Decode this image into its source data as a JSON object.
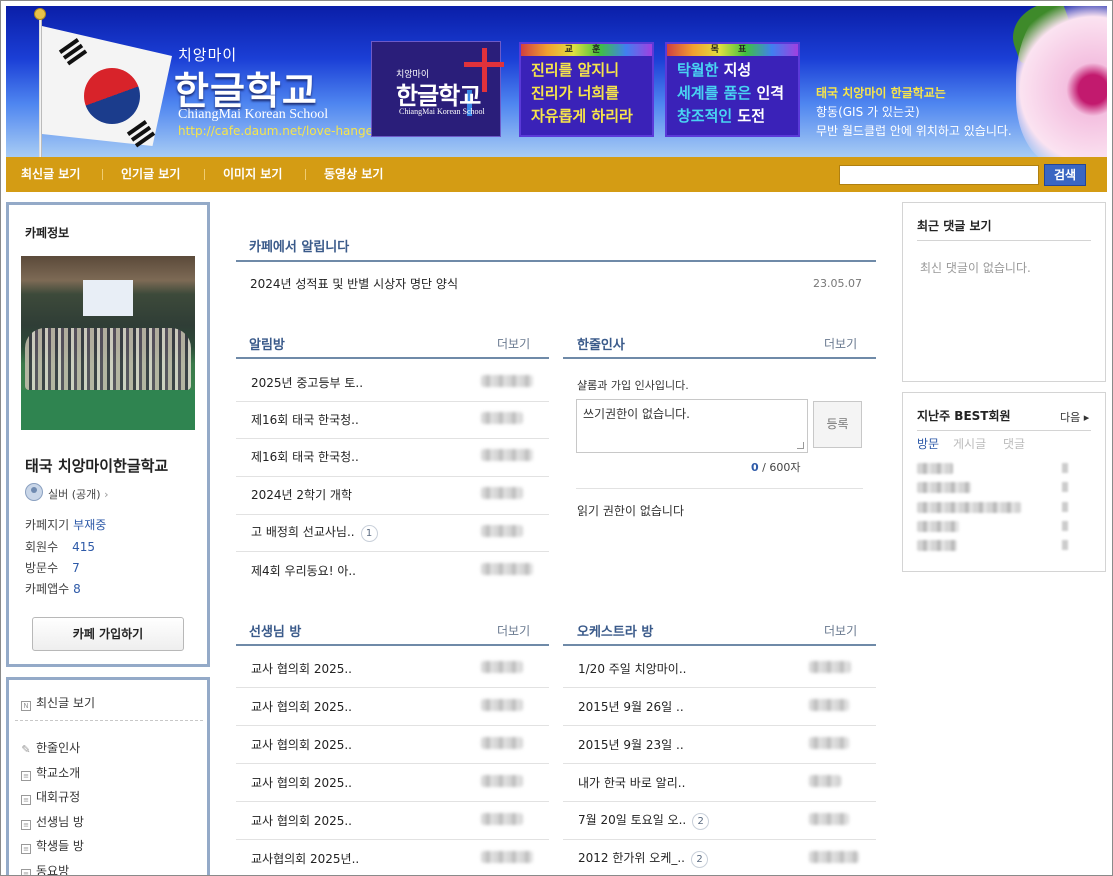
{
  "banner": {
    "small_title": "치앙마이",
    "title": "한글학교",
    "english": "ChiangMai Korean School",
    "url": "http://cafe.daum.net/love-hangeul",
    "logo_box": {
      "small": "치앙마이",
      "title": "한글학교",
      "english": "ChiangMai Korean School"
    },
    "motto": {
      "header": "교 훈",
      "lines": [
        "진리를 알지니",
        "진리가 너희를",
        "자유롭게 하리라"
      ]
    },
    "goal": {
      "header": "목 표",
      "l1a": "탁월한",
      "l1b": " 지성",
      "l2a": "세계를 품은",
      "l2b": " 인격",
      "l3a": "창조적인",
      "l3b": " 도전"
    },
    "desc": [
      "태국 치앙마이 한글학교는",
      "항동(GIS 가 있는곳)",
      "무반 월드클럽 안에 위치하고 있습니다."
    ]
  },
  "nav": {
    "items": [
      "최신글 보기",
      "인기글 보기",
      "이미지 보기",
      "동영상 보기"
    ],
    "search_button": "검색"
  },
  "cafe_info": {
    "title": "카페정보",
    "name": "태국 치앙마이한글학교",
    "grade": "실버 (공개)",
    "manager_label": "카페지기",
    "manager_value": "부재중",
    "members_label": "회원수",
    "members_value": "415",
    "visitors_label": "방문수",
    "visitors_value": "7",
    "apps_label": "카페앱수",
    "apps_value": "8",
    "join_button": "카페 가입하기"
  },
  "left_menu": {
    "recent": "최신글 보기",
    "items": [
      "한줄인사",
      "학교소개",
      "대회규정",
      "선생님 방",
      "학생들 방",
      "동요방"
    ]
  },
  "notice": {
    "title": "카페에서 알립니다",
    "row": "2024년 성적표 및 반별 시상자 명단 양식",
    "date": "23.05.07"
  },
  "board_alim": {
    "title": "알림방",
    "more": "더보기",
    "rows": [
      "2025년 중고등부 토..",
      "제16회 태국 한국청..",
      "제16회 태국 한국청..",
      "2024년 2학기 개학",
      "고 배정희 선교사님..",
      "제4회 우리동요! 아.."
    ],
    "badge_row4": "1"
  },
  "board_greet": {
    "title": "한줄인사",
    "more": "더보기",
    "desc": "샬롬과 가입 인사입니다.",
    "textarea": "쓰기권한이 없습니다.",
    "register": "등록",
    "count": "0",
    "count_max": " / 600자",
    "read_perm": "읽기 권한이 없습니다"
  },
  "board_teacher": {
    "title": "선생님 방",
    "more": "더보기",
    "rows": [
      "교사 협의회 2025..",
      "교사 협의회 2025..",
      "교사 협의회 2025..",
      "교사 협의회 2025..",
      "교사 협의회 2025..",
      "교사협의회 2025년.."
    ]
  },
  "board_orch": {
    "title": "오케스트라 방",
    "more": "더보기",
    "rows": [
      "1/20 주일 치앙마이..",
      "2015년 9월 26일 ..",
      "2015년 9월 23일 ..",
      "내가 한국 바로 알리..",
      "7월 20일 토요일 오..",
      "2012 한가위 오케_.."
    ],
    "badge_row4": "2",
    "badge_row5": "2"
  },
  "recent_comments": {
    "title": "최근 댓글 보기",
    "empty": "최신 댓글이 없습니다."
  },
  "best_members": {
    "title": "지난주 BEST회원",
    "next": "다음 ▸",
    "tabs": [
      "방문",
      "게시글",
      "댓글"
    ]
  },
  "colors": {
    "nav_bg": "#d49c14",
    "accent_blue": "#2e5aa8",
    "section_title": "#3a5a8a",
    "box_border": "#94aac8"
  }
}
